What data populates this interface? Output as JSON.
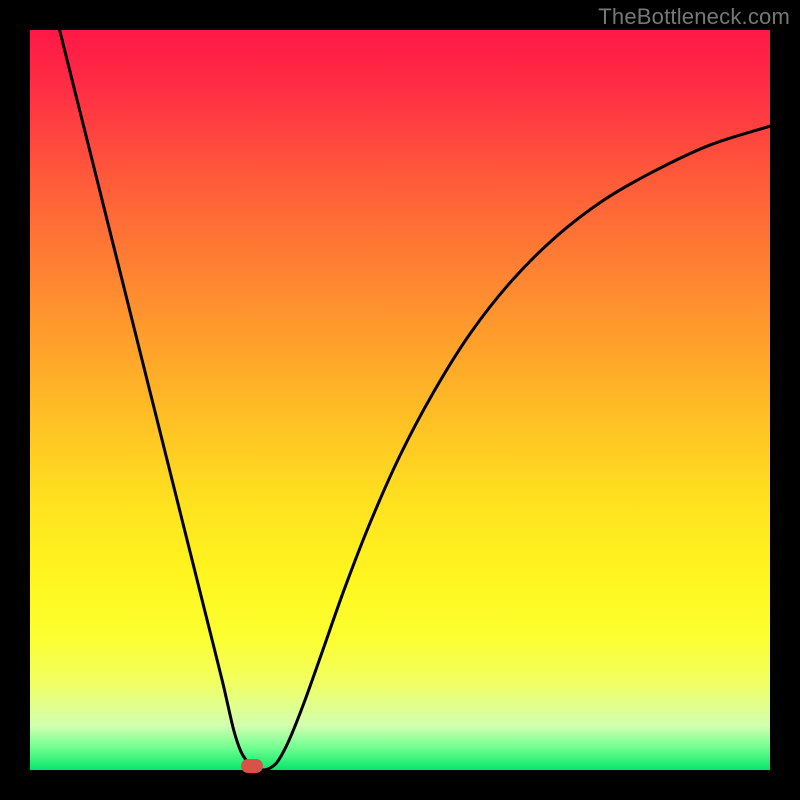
{
  "attribution": "TheBottleneck.com",
  "chart_data": {
    "type": "line",
    "title": "",
    "xlabel": "",
    "ylabel": "",
    "xlim": [
      0,
      1
    ],
    "ylim": [
      0,
      1
    ],
    "curve": [
      {
        "x": 0.04,
        "y": 1.0
      },
      {
        "x": 0.06,
        "y": 0.92
      },
      {
        "x": 0.08,
        "y": 0.84
      },
      {
        "x": 0.1,
        "y": 0.76
      },
      {
        "x": 0.12,
        "y": 0.68
      },
      {
        "x": 0.14,
        "y": 0.6
      },
      {
        "x": 0.16,
        "y": 0.52
      },
      {
        "x": 0.18,
        "y": 0.44
      },
      {
        "x": 0.2,
        "y": 0.36
      },
      {
        "x": 0.22,
        "y": 0.28
      },
      {
        "x": 0.24,
        "y": 0.2
      },
      {
        "x": 0.26,
        "y": 0.12
      },
      {
        "x": 0.275,
        "y": 0.055
      },
      {
        "x": 0.285,
        "y": 0.025
      },
      {
        "x": 0.295,
        "y": 0.01
      },
      {
        "x": 0.305,
        "y": 0.003
      },
      {
        "x": 0.315,
        "y": 0.0
      },
      {
        "x": 0.325,
        "y": 0.003
      },
      {
        "x": 0.335,
        "y": 0.012
      },
      {
        "x": 0.35,
        "y": 0.04
      },
      {
        "x": 0.37,
        "y": 0.09
      },
      {
        "x": 0.395,
        "y": 0.16
      },
      {
        "x": 0.425,
        "y": 0.245
      },
      {
        "x": 0.46,
        "y": 0.335
      },
      {
        "x": 0.5,
        "y": 0.425
      },
      {
        "x": 0.545,
        "y": 0.51
      },
      {
        "x": 0.595,
        "y": 0.59
      },
      {
        "x": 0.65,
        "y": 0.66
      },
      {
        "x": 0.71,
        "y": 0.72
      },
      {
        "x": 0.775,
        "y": 0.77
      },
      {
        "x": 0.845,
        "y": 0.81
      },
      {
        "x": 0.92,
        "y": 0.845
      },
      {
        "x": 1.0,
        "y": 0.87
      }
    ],
    "marker": {
      "x": 0.3,
      "y": 0.0,
      "color": "#d8524a"
    },
    "gradient_stops": [
      {
        "pos": 0.0,
        "color": "#ff1846"
      },
      {
        "pos": 0.08,
        "color": "#ff2e44"
      },
      {
        "pos": 0.2,
        "color": "#ff5a3a"
      },
      {
        "pos": 0.35,
        "color": "#ff8a30"
      },
      {
        "pos": 0.5,
        "color": "#ffb826"
      },
      {
        "pos": 0.64,
        "color": "#ffe21f"
      },
      {
        "pos": 0.74,
        "color": "#fff61f"
      },
      {
        "pos": 0.82,
        "color": "#fcff30"
      },
      {
        "pos": 0.88,
        "color": "#f2ff60"
      },
      {
        "pos": 0.94,
        "color": "#d2ffb0"
      },
      {
        "pos": 0.97,
        "color": "#70ff90"
      },
      {
        "pos": 1.0,
        "color": "#08e66a"
      }
    ]
  }
}
